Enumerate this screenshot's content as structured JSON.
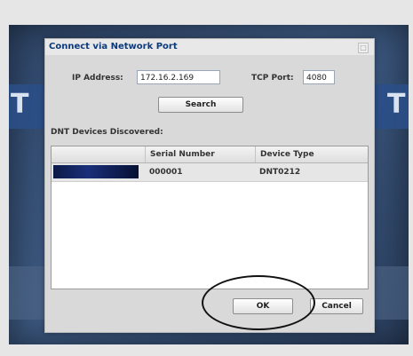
{
  "dialog": {
    "title": "Connect via Network Port",
    "close_glyph": "□",
    "ip_label": "IP Address:",
    "ip_value": "172.16.2.169",
    "tcp_label": "TCP Port:",
    "tcp_value": "4080",
    "search_label": "Search",
    "devices_label": "DNT Devices Discovered:",
    "table": {
      "columns": [
        "",
        "Serial Number",
        "Device Type"
      ],
      "rows": [
        {
          "name": "",
          "serial": "000001",
          "type": "DNT0212"
        }
      ]
    },
    "ok_label": "OK",
    "cancel_label": "Cancel"
  },
  "background": {
    "left_letters": "T",
    "right_letters": "T"
  },
  "colors": {
    "title_text": "#0c3a7d",
    "dialog_bg": "#d9d9d9",
    "screen_bg": "#2f4669"
  }
}
